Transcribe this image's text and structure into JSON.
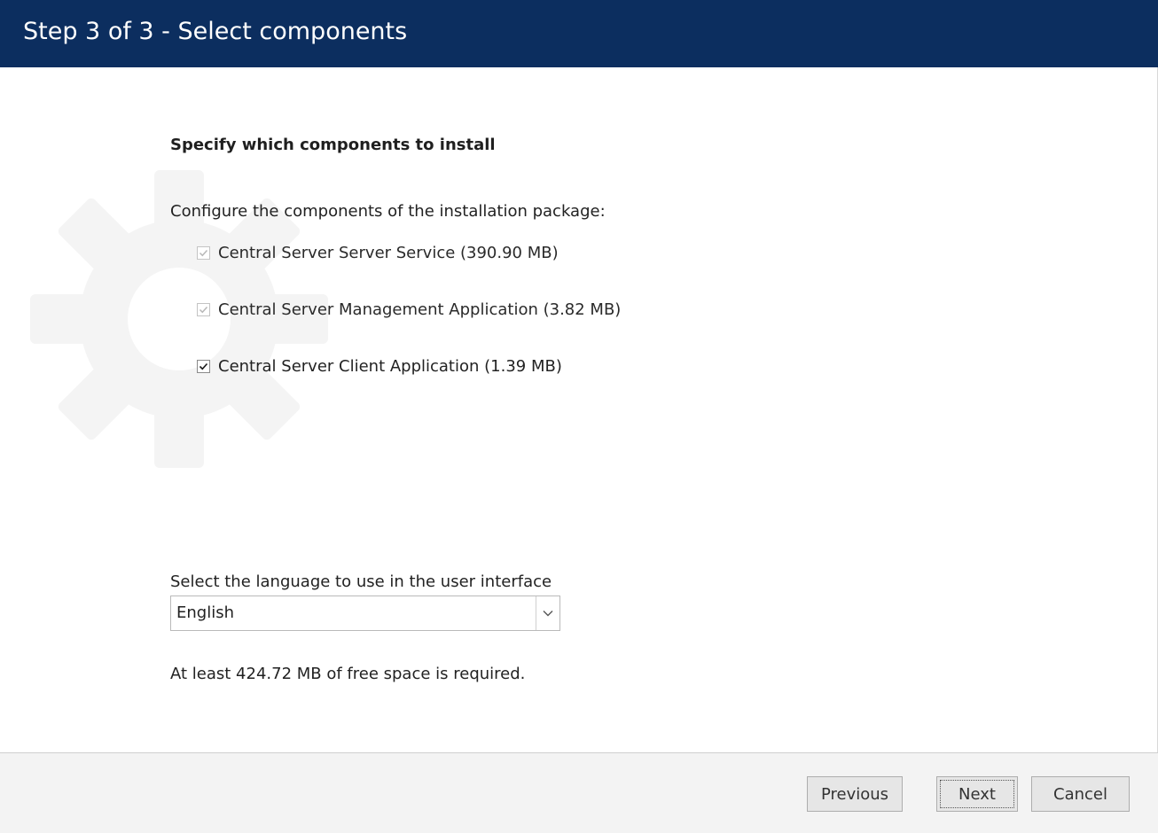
{
  "window": {
    "title": "Step 3 of 3 - Select components"
  },
  "main": {
    "heading": "Specify which components to install",
    "configure_label": "Configure the components of the installation package:",
    "components": [
      {
        "label": "Central Server Server Service (390.90 MB)",
        "checked": true,
        "disabled": true
      },
      {
        "label": "Central Server Management Application (3.82 MB)",
        "checked": true,
        "disabled": true
      },
      {
        "label": "Central Server Client Application (1.39 MB)",
        "checked": true,
        "disabled": false
      }
    ],
    "language_label": "Select the language to use in the user interface",
    "language_selected": "English",
    "space_note": "At least 424.72 MB of free space is required."
  },
  "footer": {
    "previous_label": "Previous",
    "next_label": "Next",
    "cancel_label": "Cancel"
  },
  "colors": {
    "title_bar": "#0c2e5f",
    "footer_bg": "#f3f3f3",
    "gear_watermark": "#f4f4f4"
  },
  "icons": {
    "watermark": "gear-icon",
    "checkbox_mark": "checkmark-icon",
    "dropdown": "chevron-down-icon"
  }
}
